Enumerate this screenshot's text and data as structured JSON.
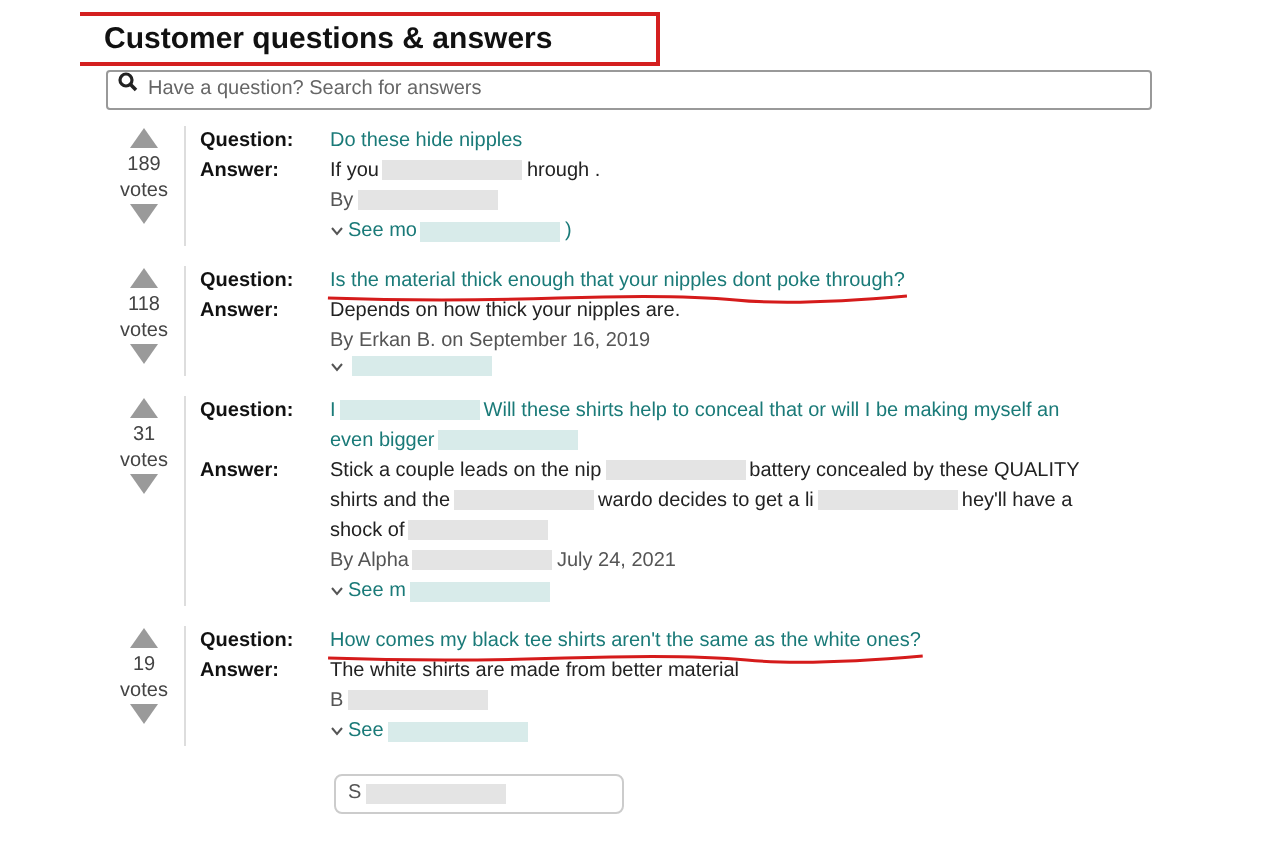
{
  "title": {
    "text": "Customer questions & answers",
    "boxed": true
  },
  "search": {
    "placeholder": "Have a question? Search for answers"
  },
  "items": [
    {
      "votes": "189",
      "votes_label": "votes",
      "question_label": "Question:",
      "answer_label": "Answer:",
      "question_underlined": false,
      "question_lines": [
        [
          {
            "kind": "text",
            "text": "Do these hide nipples"
          }
        ]
      ],
      "answer_lines": [
        [
          {
            "kind": "text",
            "text": "If you"
          },
          {
            "kind": "redacted"
          },
          {
            "kind": "text",
            "text": "hrough ."
          }
        ]
      ],
      "byline": [
        {
          "kind": "text",
          "text": "By"
        },
        {
          "kind": "redacted"
        }
      ],
      "see_more": [
        {
          "kind": "text",
          "text": "See mo"
        },
        {
          "kind": "redacted"
        },
        {
          "kind": "text",
          "text": ")"
        }
      ]
    },
    {
      "votes": "118",
      "votes_label": "votes",
      "question_label": "Question:",
      "answer_label": "Answer:",
      "question_underlined": true,
      "question_lines": [
        [
          {
            "kind": "text",
            "text": "Is the material thick enough that your nipples dont poke through?"
          }
        ]
      ],
      "answer_lines": [
        [
          {
            "kind": "text",
            "text": "Depends on how thick your nipples are."
          }
        ]
      ],
      "byline": [
        {
          "kind": "text",
          "text": "By Erkan B. on September 16, 2019"
        }
      ],
      "see_more": [
        {
          "kind": "redacted"
        }
      ]
    },
    {
      "votes": "31",
      "votes_label": "votes",
      "question_label": "Question:",
      "answer_label": "Answer:",
      "question_underlined": false,
      "question_lines": [
        [
          {
            "kind": "text",
            "text": "I"
          },
          {
            "kind": "redacted"
          },
          {
            "kind": "text",
            "text": "Will these shirts help to conceal that or will I be making myself an"
          }
        ],
        [
          {
            "kind": "text",
            "text": "even bigger"
          },
          {
            "kind": "redacted"
          }
        ]
      ],
      "answer_lines": [
        [
          {
            "kind": "text",
            "text": "Stick a couple leads on the nip"
          },
          {
            "kind": "redacted"
          },
          {
            "kind": "text",
            "text": "battery concealed by these QUALITY"
          }
        ],
        [
          {
            "kind": "text",
            "text": "shirts and the"
          },
          {
            "kind": "redacted"
          },
          {
            "kind": "text",
            "text": "wardo decides to get a li"
          },
          {
            "kind": "redacted"
          },
          {
            "kind": "text",
            "text": "hey'll have a"
          }
        ],
        [
          {
            "kind": "text",
            "text": "shock of"
          },
          {
            "kind": "redacted"
          }
        ]
      ],
      "byline": [
        {
          "kind": "text",
          "text": "By Alpha"
        },
        {
          "kind": "redacted"
        },
        {
          "kind": "text",
          "text": "July 24, 2021"
        }
      ],
      "see_more": [
        {
          "kind": "text",
          "text": "See m"
        },
        {
          "kind": "redacted"
        }
      ]
    },
    {
      "votes": "19",
      "votes_label": "votes",
      "question_label": "Question:",
      "answer_label": "Answer:",
      "question_underlined": true,
      "question_lines": [
        [
          {
            "kind": "text",
            "text": "How comes my black tee shirts aren't the same as the white ones?"
          }
        ]
      ],
      "answer_lines": [
        [
          {
            "kind": "text",
            "text": "The white shirts are made from better material"
          }
        ]
      ],
      "byline": [
        {
          "kind": "text",
          "text": "B"
        },
        {
          "kind": "redacted"
        }
      ],
      "see_more": [
        {
          "kind": "text",
          "text": "See"
        },
        {
          "kind": "redacted"
        }
      ]
    }
  ],
  "more_button": [
    {
      "kind": "text",
      "text": "S"
    },
    {
      "kind": "redacted"
    }
  ]
}
